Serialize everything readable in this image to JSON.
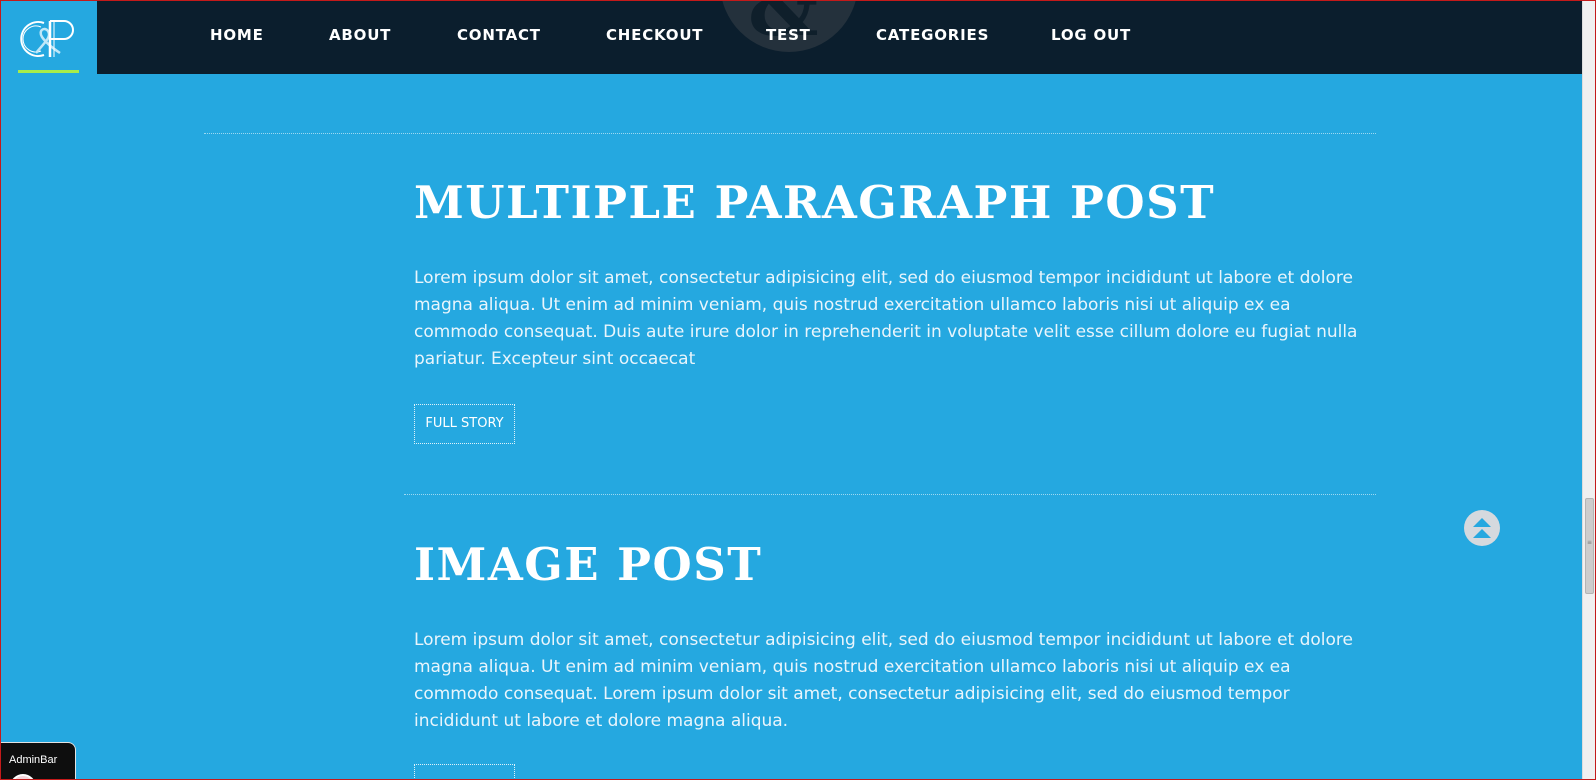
{
  "brand": {
    "logo_text": "C&P",
    "accent_color": "#a8ec4a",
    "background_color": "#25a8e0",
    "nav_background": "#0b1e2d",
    "watermark_glyph": "&"
  },
  "nav": {
    "items": [
      {
        "label": "HOME"
      },
      {
        "label": "ABOUT"
      },
      {
        "label": "CONTACT"
      },
      {
        "label": "CHECKOUT"
      },
      {
        "label": "TEST"
      },
      {
        "label": "CATEGORIES"
      },
      {
        "label": "LOG OUT"
      }
    ]
  },
  "posts": [
    {
      "title": "MULTIPLE PARAGRAPH POST",
      "body": "Lorem ipsum dolor sit amet, consectetur adipisicing elit, sed do eiusmod tempor incididunt ut labore et dolore magna aliqua. Ut enim ad minim veniam, quis nostrud exercitation ullamco laboris nisi ut aliquip ex ea commodo consequat. Duis aute irure dolor in reprehenderit in voluptate velit esse cillum dolore eu fugiat nulla pariatur. Excepteur sint occaecat",
      "button_label": "FULL STORY"
    },
    {
      "title": "IMAGE POST",
      "body": "Lorem ipsum dolor sit amet, consectetur adipisicing elit, sed do eiusmod tempor incididunt ut labore et dolore magna aliqua. Ut enim ad minim veniam, quis nostrud exercitation ullamco laboris nisi ut aliquip ex ea commodo consequat. Lorem ipsum dolor sit amet, consectetur adipisicing elit, sed do eiusmod tempor incididunt ut labore et dolore magna aliqua.",
      "button_label": ""
    }
  ],
  "scroll_to_top": {
    "icon": "double-chevron-up-icon"
  },
  "admin_bar": {
    "label": "AdminBar",
    "icon": "avatar"
  }
}
